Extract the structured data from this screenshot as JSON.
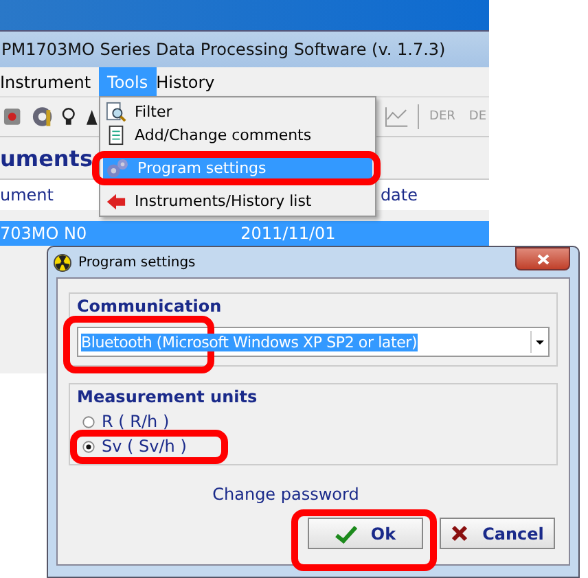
{
  "app_window": {
    "title": "PM1703MO Series Data Processing Software (v. 1.7.3)",
    "menu": [
      {
        "label": "Instrument",
        "selected": false
      },
      {
        "label": "Tools",
        "selected": true
      },
      {
        "label": "History",
        "selected": false
      }
    ],
    "toolbar_labels": [
      "DER",
      "DE"
    ],
    "heading": "uments",
    "columns": [
      "ument",
      "date"
    ],
    "rows": [
      {
        "cells": [
          "703MO N0",
          "2011/11/01"
        ],
        "selected": true
      }
    ]
  },
  "tools_menu": {
    "items": [
      {
        "label": "Filter",
        "selected": false,
        "kind": "filter"
      },
      {
        "label": "Add/Change comments",
        "selected": false,
        "kind": "comments"
      },
      {
        "label": "Program settings",
        "selected": true,
        "kind": "settings"
      },
      {
        "label": "Instruments/History list",
        "selected": false,
        "kind": "list"
      }
    ]
  },
  "dialog": {
    "title": "Program settings",
    "communication": {
      "label": "Communication",
      "value": "Bluetooth (Microsoft Windows XP SP2 or later)"
    },
    "measurement_units": {
      "label": "Measurement units",
      "options": [
        {
          "label": "R ( R/h )",
          "selected": false
        },
        {
          "label": "Sv ( Sv/h )",
          "selected": true
        }
      ]
    },
    "link": "Change password",
    "buttons": [
      {
        "label": "Ok",
        "kind": "ok"
      },
      {
        "label": "Cancel",
        "kind": "cancel"
      }
    ]
  }
}
